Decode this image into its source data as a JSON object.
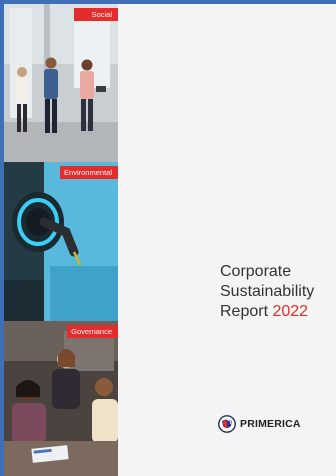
{
  "panels": [
    {
      "label": "Social"
    },
    {
      "label": "Environmental"
    },
    {
      "label": "Governance"
    }
  ],
  "title": {
    "line1": "Corporate",
    "line2": "Sustainability",
    "line3_prefix": "Report",
    "line3_year": "2022"
  },
  "brand": {
    "name": "PRIMERICA",
    "accent_color": "#e32c2b",
    "logo_icon": "primerica-shield-icon"
  }
}
